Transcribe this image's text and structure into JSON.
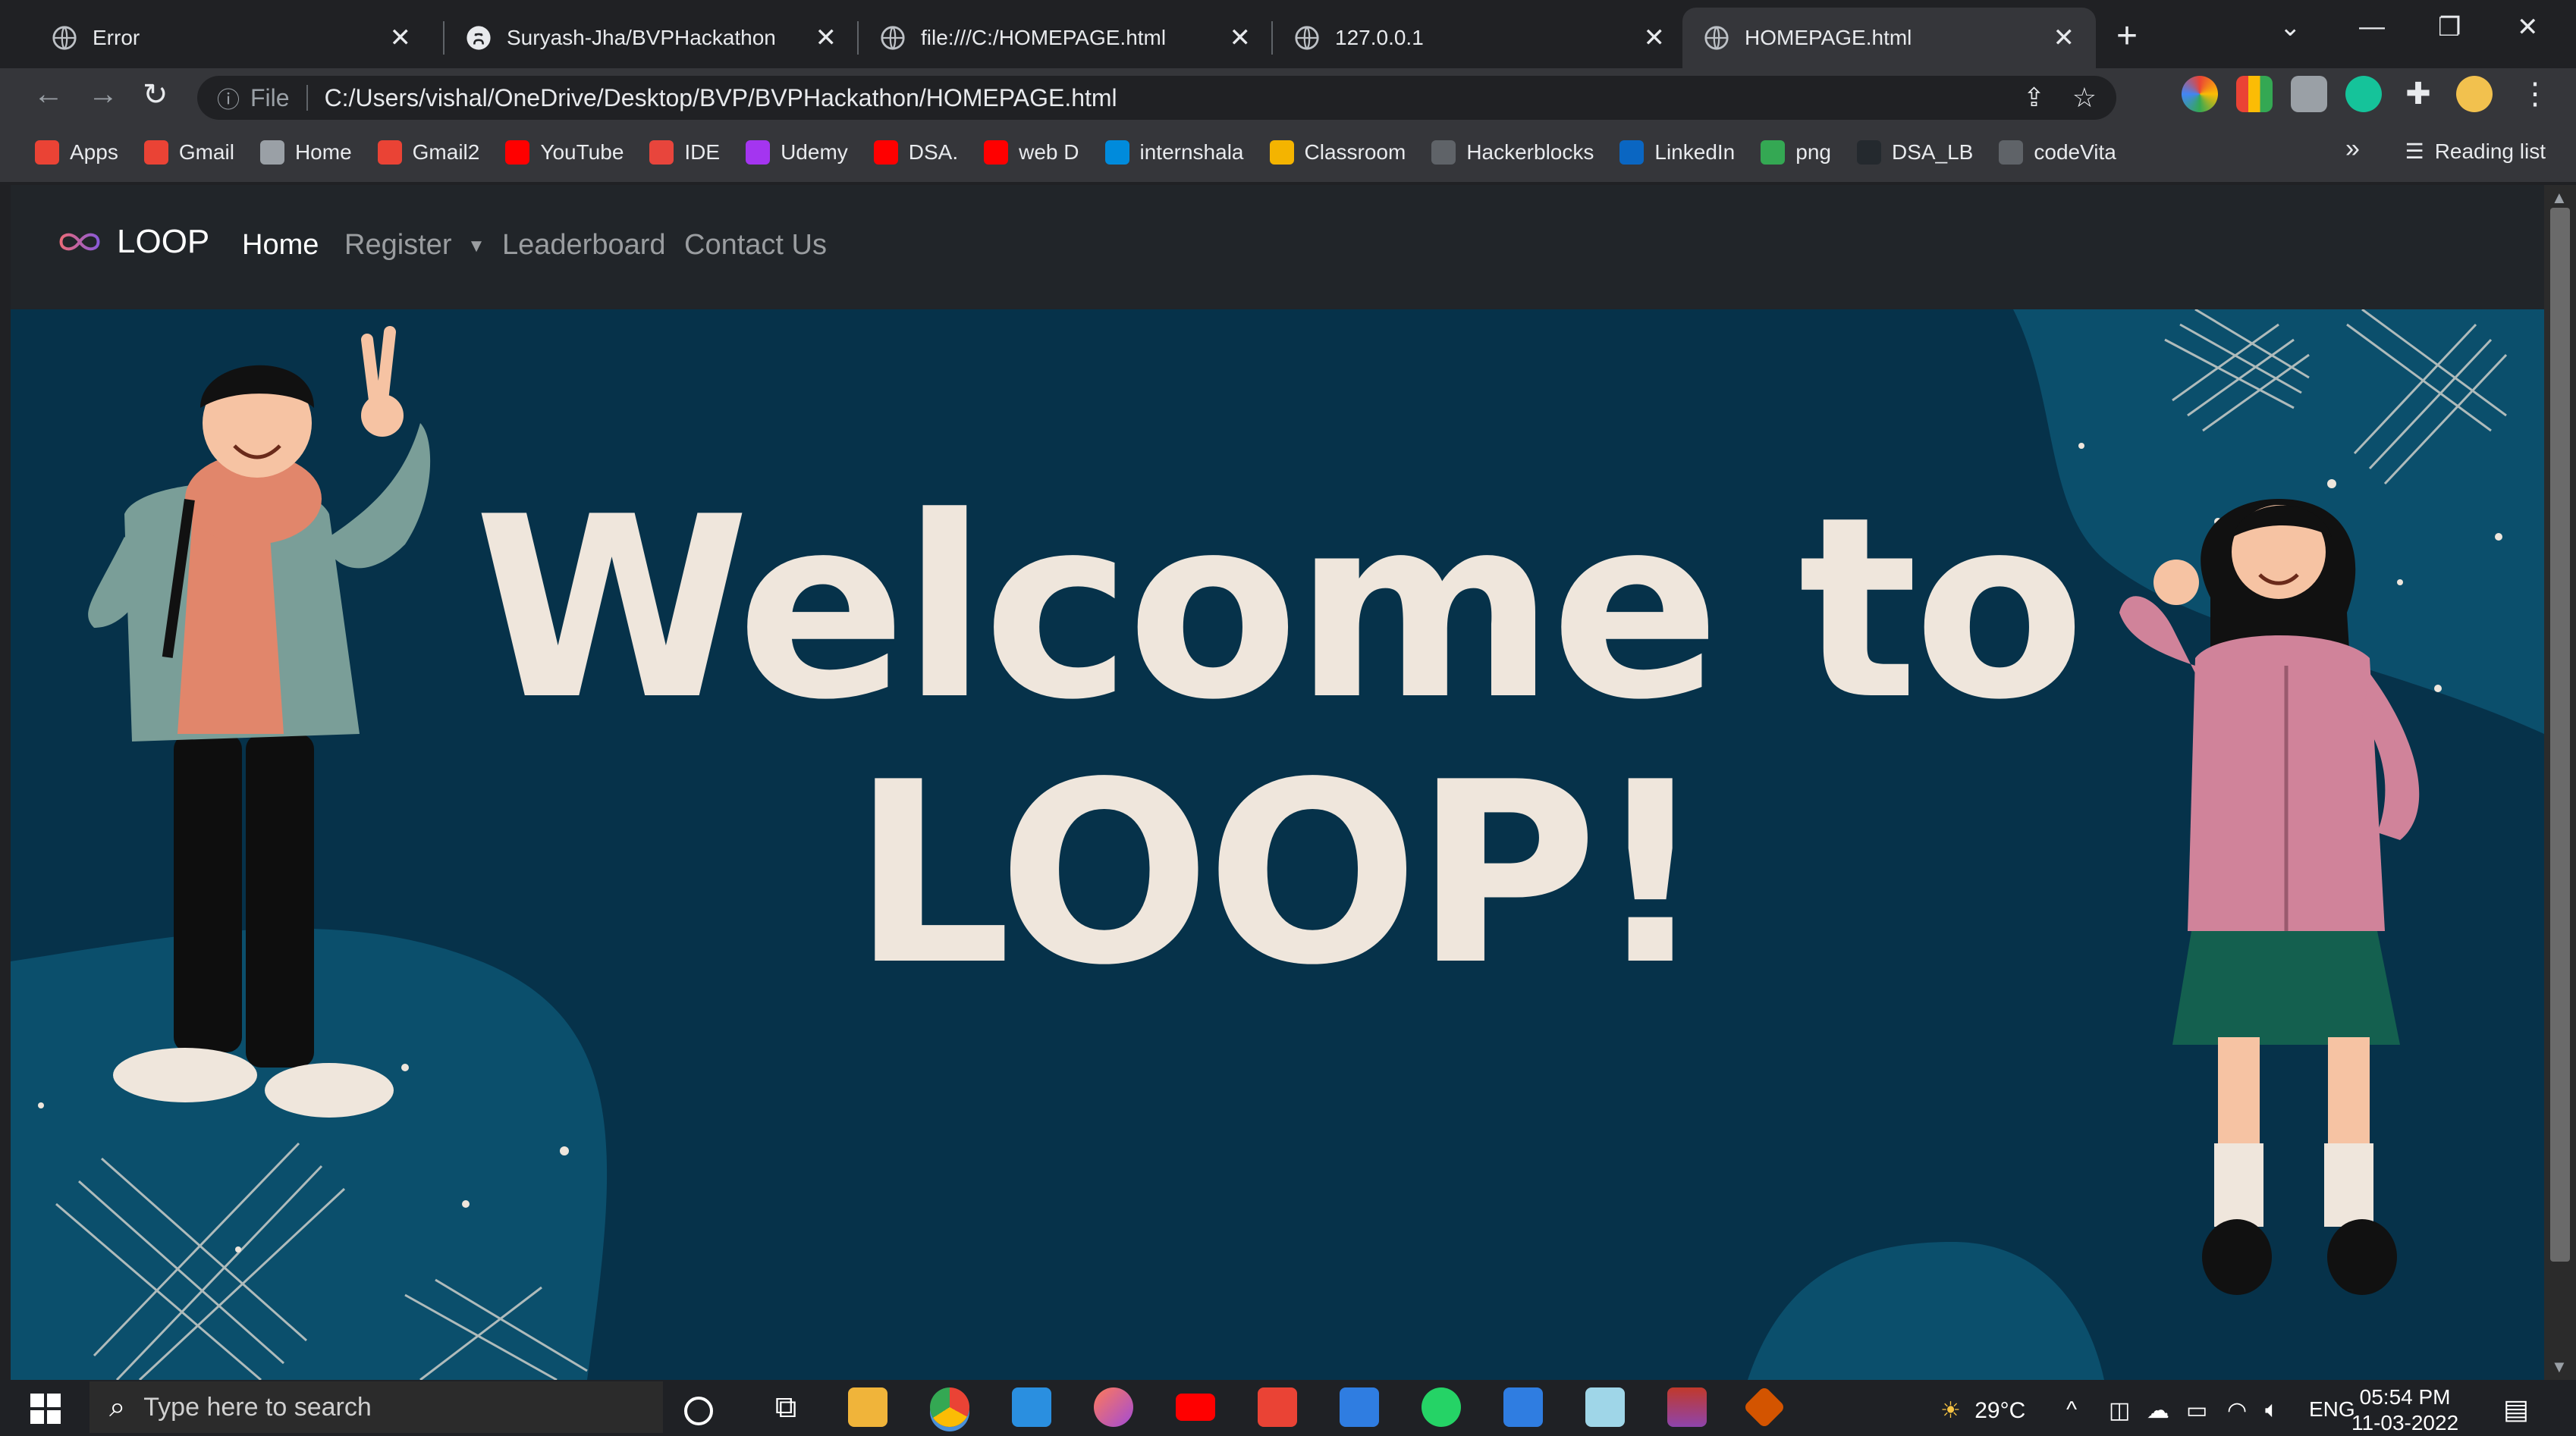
{
  "tabs": [
    {
      "title": "Error",
      "active": false
    },
    {
      "title": "Suryash-Jha/BVPHackathon",
      "active": false
    },
    {
      "title": "file:///C:/HOMEPAGE.html",
      "active": false
    },
    {
      "title": "127.0.0.1",
      "active": false
    },
    {
      "title": "HOMEPAGE.html",
      "active": true
    }
  ],
  "address": {
    "scheme_label": "File",
    "url": "C:/Users/vishal/OneDrive/Desktop/BVP/BVPHackathon/HOMEPAGE.html"
  },
  "bookmarks": [
    {
      "label": "Apps",
      "icon": "apps-grid-icon",
      "color": "#ea4335"
    },
    {
      "label": "Gmail",
      "icon": "gmail-icon",
      "color": "#ea4335"
    },
    {
      "label": "Home",
      "icon": "globe-icon",
      "color": "#9aa0a6"
    },
    {
      "label": "Gmail2",
      "icon": "gmail-icon",
      "color": "#ea4335"
    },
    {
      "label": "YouTube",
      "icon": "youtube-icon",
      "color": "#ff0000"
    },
    {
      "label": "IDE",
      "icon": "ide-icon",
      "color": "#e8453c"
    },
    {
      "label": "Udemy",
      "icon": "udemy-icon",
      "color": "#a435f0"
    },
    {
      "label": "DSA.",
      "icon": "youtube-icon",
      "color": "#ff0000"
    },
    {
      "label": "web D",
      "icon": "youtube-icon",
      "color": "#ff0000"
    },
    {
      "label": "internshala",
      "icon": "internshala-icon",
      "color": "#008bdc"
    },
    {
      "label": "Classroom",
      "icon": "classroom-icon",
      "color": "#f4b400"
    },
    {
      "label": "Hackerblocks",
      "icon": "hackerblocks-icon",
      "color": "#5f6368"
    },
    {
      "label": "LinkedIn",
      "icon": "linkedin-icon",
      "color": "#0a66c2"
    },
    {
      "label": "png",
      "icon": "leaf-icon",
      "color": "#34a853"
    },
    {
      "label": "DSA_LB",
      "icon": "github-icon",
      "color": "#24292e"
    },
    {
      "label": "codeVita",
      "icon": "codevita-icon",
      "color": "#5f6368"
    }
  ],
  "reading_list": "Reading list",
  "site": {
    "brand": "LOOP",
    "nav": {
      "home": "Home",
      "register": "Register",
      "leaderboard": "Leaderboard",
      "contact": "Contact Us"
    },
    "hero_line1": "Welcome to",
    "hero_line2": "LOOP!"
  },
  "taskbar": {
    "search_placeholder": "Type here to search",
    "weather": "29°C",
    "language": "ENG",
    "time": "05:54 PM",
    "date": "11-03-2022"
  },
  "colors": {
    "hero_bg": "#06324a",
    "hero_text": "#efe6dc",
    "blob": "#0b4f6c",
    "navbar": "#212529"
  }
}
